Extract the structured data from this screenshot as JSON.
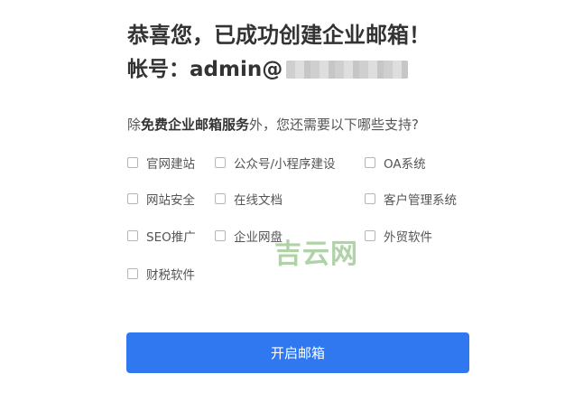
{
  "heading": "恭喜您，已成功创建企业邮箱！",
  "account": {
    "label": "帐号：",
    "value": "admin@"
  },
  "question": {
    "prefix": "除",
    "highlight": "免费企业邮箱服务",
    "suffix": "外，您还需要以下哪些支持?"
  },
  "options": [
    {
      "label": "官网建站"
    },
    {
      "label": "公众号/小程序建设"
    },
    {
      "label": "OA系统"
    },
    {
      "label": "网站安全"
    },
    {
      "label": "在线文档"
    },
    {
      "label": "客户管理系统"
    },
    {
      "label": "SEO推广"
    },
    {
      "label": "企业网盘"
    },
    {
      "label": "外贸软件"
    },
    {
      "label": "财税软件"
    }
  ],
  "watermark": "吉云网",
  "submit_label": "开启邮箱"
}
